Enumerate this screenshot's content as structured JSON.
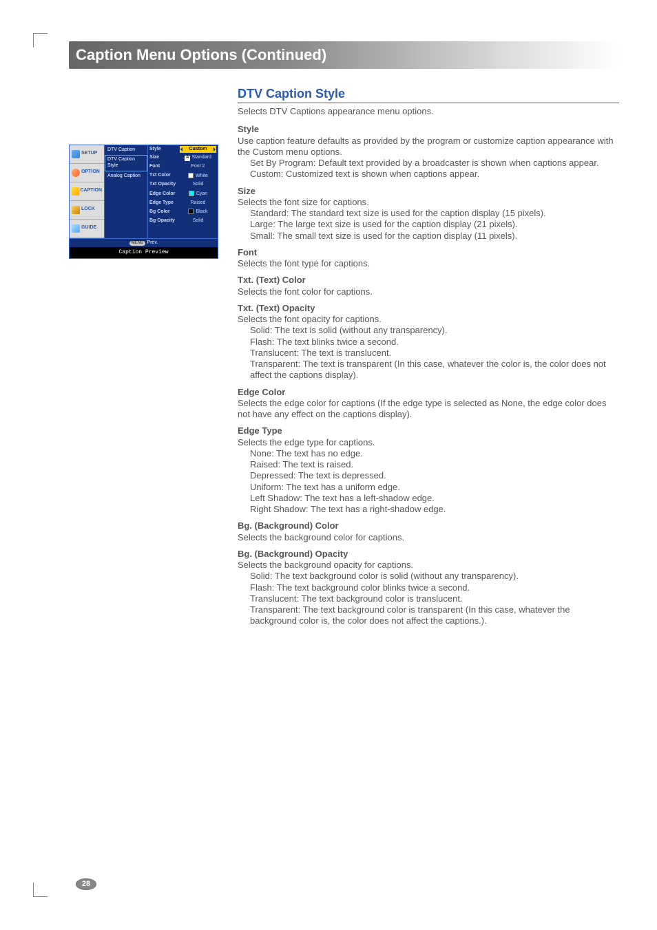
{
  "page_title": "Caption Menu Options (Continued)",
  "page_number": "28",
  "osd": {
    "nav": [
      {
        "label": "SETUP",
        "icon": "ic-setup"
      },
      {
        "label": "OPTION",
        "icon": "ic-option"
      },
      {
        "label": "CAPTION",
        "icon": "ic-caption"
      },
      {
        "label": "LOCK",
        "icon": "ic-lock"
      },
      {
        "label": "GUIDE",
        "icon": "ic-guide"
      }
    ],
    "sub": [
      {
        "label": "DTV Caption"
      },
      {
        "label": "DTV Caption Style"
      },
      {
        "label": "Analog Caption"
      }
    ],
    "rows": [
      {
        "label": "Style",
        "value": "Custom",
        "hl": true
      },
      {
        "label": "Size",
        "value": "Standard",
        "akey": "A"
      },
      {
        "label": "Font",
        "value": "Font 2"
      },
      {
        "label": "Txt Color",
        "value": "White",
        "swatch": "sw-white"
      },
      {
        "label": "Txt Opacity",
        "value": "Solid"
      },
      {
        "label": "Edge Color",
        "value": "Cyan",
        "swatch": "sw-cyan"
      },
      {
        "label": "Edge Type",
        "value": "Raised"
      },
      {
        "label": "Bg Color",
        "value": "Black",
        "swatch": "sw-black"
      },
      {
        "label": "Bg Opacity",
        "value": "Solid"
      }
    ],
    "footer_key": "MENU",
    "footer_label": "Prev.",
    "preview": "Caption Preview"
  },
  "section_title": "DTV Caption Style",
  "lead": "Selects DTV Captions appearance menu options.",
  "blocks": [
    {
      "head": "Style",
      "body": "Use caption feature defaults as provided by the program or customize caption appearance with the Custom menu options.",
      "items": [
        "Set By Program: Default text provided by a broadcaster is shown when captions appear.",
        "Custom: Customized text is shown when captions appear."
      ]
    },
    {
      "head": "Size",
      "body": "Selects the font size for captions.",
      "items": [
        "Standard: The standard text size is used for the caption display (15 pixels).",
        "Large: The large text size is used for the caption display (21 pixels).",
        "Small: The small text size is used for the caption display (11 pixels)."
      ]
    },
    {
      "head": "Font",
      "body": "Selects the font type for captions."
    },
    {
      "head": "Txt. (Text) Color",
      "body": "Selects the font color for captions."
    },
    {
      "head": "Txt. (Text) Opacity",
      "body": "Selects the font opacity for captions.",
      "items": [
        "Solid: The text is solid (without any transparency).",
        "Flash: The text blinks twice a second.",
        "Translucent: The text is translucent.",
        "Transparent: The text is transparent (In this case, whatever the color is, the color does not affect the captions display)."
      ]
    },
    {
      "head": "Edge Color",
      "body": "Selects the edge color for captions (If the edge type is selected as None, the edge color does not have any effect on the captions display)."
    },
    {
      "head": "Edge Type",
      "body": "Selects the edge type for captions.",
      "items": [
        "None: The text has no edge.",
        "Raised: The text is raised.",
        "Depressed: The text is depressed.",
        "Uniform: The text has a uniform edge.",
        "Left Shadow: The text has a left-shadow edge.",
        "Right Shadow: The text has a right-shadow edge."
      ]
    },
    {
      "head": "Bg. (Background) Color",
      "body": "Selects the background color for captions."
    },
    {
      "head": "Bg. (Background) Opacity",
      "body": "Selects the background opacity for captions.",
      "items": [
        "Solid: The text background color is solid (without any transparency).",
        "Flash: The text background color blinks twice a second.",
        "Translucent: The text background color is translucent.",
        "Transparent: The text background color is transparent (In this case, whatever the background color is, the color does not affect the captions.)."
      ]
    }
  ]
}
